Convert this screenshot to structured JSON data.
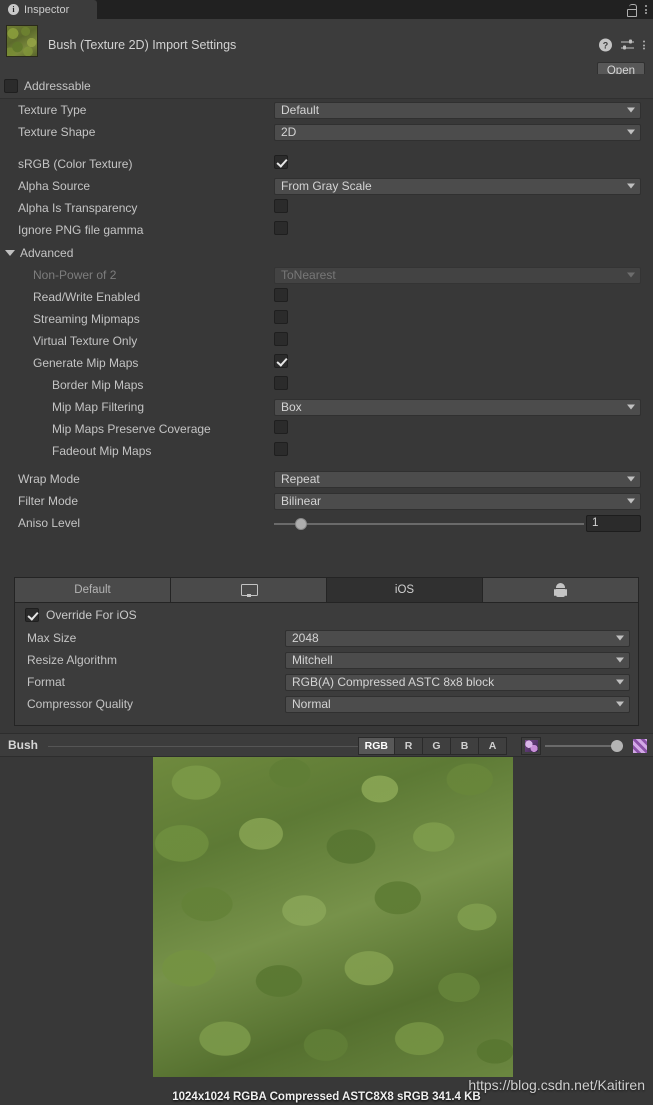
{
  "window": {
    "tab_label": "Inspector",
    "tab_icon": "info-icon",
    "lock_icon": "lock-icon",
    "menu_icon": "kebab-menu-icon"
  },
  "header": {
    "title": "Bush (Texture 2D) Import Settings",
    "thumbnail_name": "texture-thumbnail",
    "help_icon": "help-icon",
    "preset_icon": "preset-icon",
    "menu_icon": "kebab-menu-icon",
    "open_label": "Open"
  },
  "addressable": {
    "label": "Addressable",
    "checked": false
  },
  "main_settings": [
    {
      "label": "Texture Type",
      "type": "dropdown",
      "value": "Default",
      "disabled": false
    },
    {
      "label": "Texture Shape",
      "type": "dropdown",
      "value": "2D",
      "disabled": false
    },
    {
      "label": "sRGB (Color Texture)",
      "type": "checkbox",
      "value": true,
      "disabled": false
    },
    {
      "label": "Alpha Source",
      "type": "dropdown",
      "value": "From Gray Scale",
      "disabled": false
    },
    {
      "label": "Alpha Is Transparency",
      "type": "checkbox",
      "value": false,
      "disabled": false
    },
    {
      "label": "Ignore PNG file gamma",
      "type": "checkbox",
      "value": false,
      "disabled": false
    }
  ],
  "advanced": {
    "label": "Advanced",
    "expanded": true,
    "items": [
      {
        "label": "Non-Power of 2",
        "type": "dropdown",
        "value": "ToNearest",
        "disabled": true,
        "indent": 1
      },
      {
        "label": "Read/Write Enabled",
        "type": "checkbox",
        "value": false,
        "disabled": false,
        "indent": 1
      },
      {
        "label": "Streaming Mipmaps",
        "type": "checkbox",
        "value": false,
        "disabled": false,
        "indent": 1
      },
      {
        "label": "Virtual Texture Only",
        "type": "checkbox",
        "value": false,
        "disabled": false,
        "indent": 1
      },
      {
        "label": "Generate Mip Maps",
        "type": "checkbox",
        "value": true,
        "disabled": false,
        "indent": 1
      },
      {
        "label": "Border Mip Maps",
        "type": "checkbox",
        "value": false,
        "disabled": false,
        "indent": 2
      },
      {
        "label": "Mip Map Filtering",
        "type": "dropdown",
        "value": "Box",
        "disabled": false,
        "indent": 2
      },
      {
        "label": "Mip Maps Preserve Coverage",
        "type": "checkbox",
        "value": false,
        "disabled": false,
        "indent": 2
      },
      {
        "label": "Fadeout Mip Maps",
        "type": "checkbox",
        "value": false,
        "disabled": false,
        "indent": 2
      }
    ]
  },
  "filtering": [
    {
      "label": "Wrap Mode",
      "type": "dropdown",
      "value": "Repeat"
    },
    {
      "label": "Filter Mode",
      "type": "dropdown",
      "value": "Bilinear"
    }
  ],
  "aniso": {
    "label": "Aniso Level",
    "value": "1",
    "slider_percent": 7
  },
  "platform_tabs": [
    {
      "label": "Default",
      "icon": null,
      "selected": false
    },
    {
      "label": "",
      "icon": "monitor-icon",
      "selected": false
    },
    {
      "label": "iOS",
      "icon": null,
      "selected": true
    },
    {
      "label": "",
      "icon": "android-icon",
      "selected": false
    }
  ],
  "platform_panel": {
    "override_label": "Override For iOS",
    "override_checked": true,
    "rows": [
      {
        "label": "Max Size",
        "value": "2048"
      },
      {
        "label": "Resize Algorithm",
        "value": "Mitchell"
      },
      {
        "label": "Format",
        "value": "RGB(A) Compressed ASTC 8x8 block"
      },
      {
        "label": "Compressor Quality",
        "value": "Normal"
      }
    ]
  },
  "preview_bar": {
    "name": "Bush",
    "channels": [
      {
        "label": "RGB",
        "selected": true
      },
      {
        "label": "R",
        "selected": false
      },
      {
        "label": "G",
        "selected": false
      },
      {
        "label": "B",
        "selected": false
      },
      {
        "label": "A",
        "selected": false
      }
    ],
    "mip_icon": "mipmap-icon",
    "checkerboard_icon": "checkerboard-icon"
  },
  "preview": {
    "status": "1024x1024  RGBA Compressed ASTC8X8 sRGB   341.4 KB",
    "watermark": "https://blog.csdn.net/Kaitiren"
  },
  "colors": {
    "window_bg": "#383838",
    "panel_bg": "#3c3c3c",
    "tabbar_bg": "#212121",
    "dropdown_bg": "#4c4c4c",
    "text": "#c4c4c4",
    "text_dim": "#7d7d7d",
    "selected_tab": "#585858"
  }
}
